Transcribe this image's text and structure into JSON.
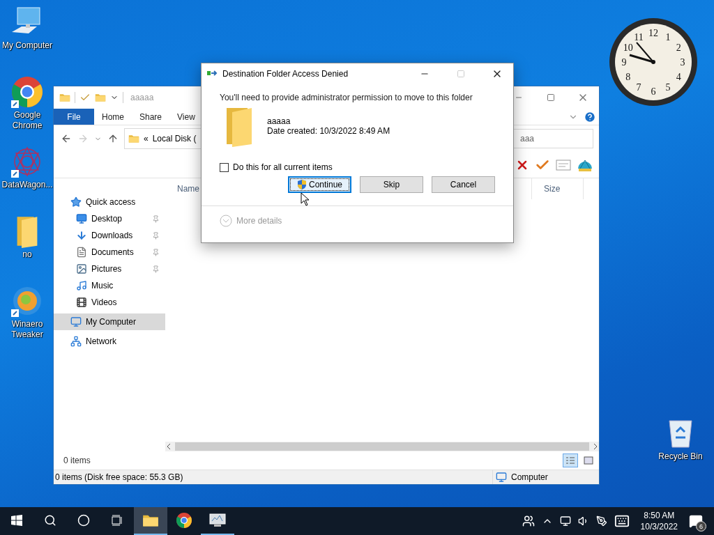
{
  "desktop_icons": [
    {
      "label": "My Computer",
      "kind": "computer"
    },
    {
      "label": "Google Chrome",
      "kind": "chrome"
    },
    {
      "label": "DataWagon...",
      "kind": "datawagon"
    },
    {
      "label": "no",
      "kind": "folder"
    },
    {
      "label": "Winaero Tweaker",
      "kind": "winaero"
    }
  ],
  "recycle_bin": {
    "label": "Recycle Bin"
  },
  "clock": {
    "numerals": [
      "12",
      "11",
      "1",
      "10",
      "2",
      "9",
      "3",
      "8",
      "4",
      "7",
      "5",
      "6"
    ]
  },
  "explorer": {
    "title": "aaaaa",
    "ribbon_tabs": [
      {
        "label": "File",
        "selected": true
      },
      {
        "label": "Home",
        "selected": false
      },
      {
        "label": "Share",
        "selected": false
      },
      {
        "label": "View",
        "selected": false
      }
    ],
    "address_overflow": "«",
    "address": "Local Disk (",
    "search": "aaa",
    "columns": [
      "Name",
      "Size"
    ],
    "nav": [
      {
        "label": "Quick access",
        "kind": "star",
        "selected": false,
        "children": [
          {
            "label": "Desktop",
            "kind": "desktop",
            "pinned": true,
            "selected": false
          },
          {
            "label": "Downloads",
            "kind": "downloads",
            "pinned": true,
            "selected": false
          },
          {
            "label": "Documents",
            "kind": "documents",
            "pinned": true,
            "selected": false
          },
          {
            "label": "Pictures",
            "kind": "pictures",
            "pinned": true,
            "selected": false
          },
          {
            "label": "Music",
            "kind": "music",
            "pinned": false,
            "selected": false
          },
          {
            "label": "Videos",
            "kind": "videos",
            "pinned": false,
            "selected": false
          }
        ]
      },
      {
        "label": "My Computer",
        "kind": "computer",
        "selected": true
      },
      {
        "label": "Network",
        "kind": "network",
        "selected": false
      }
    ],
    "item_count": "0 items",
    "status_text": "0 items (Disk free space: 55.3 GB)",
    "status_location": "Computer"
  },
  "dialog": {
    "title": "Destination Folder Access Denied",
    "message": "You'll need to provide administrator permission to move to this folder",
    "item_name": "aaaaa",
    "item_date": "Date created: 10/3/2022 8:49 AM",
    "checkbox": {
      "label": "Do this for all current items",
      "checked": false
    },
    "buttons": [
      {
        "label": "Continue",
        "kind": "elevated",
        "focused": true
      },
      {
        "label": "Skip",
        "kind": "plain",
        "focused": false
      },
      {
        "label": "Cancel",
        "kind": "plain",
        "focused": false
      }
    ],
    "more_details": "More details"
  },
  "taskbar": {
    "apps": [
      {
        "kind": "explorer",
        "open": true,
        "active": true
      },
      {
        "kind": "chrome",
        "open": false,
        "active": false
      },
      {
        "kind": "monitor",
        "open": true,
        "active": false
      }
    ],
    "time": "8:50 AM",
    "date": "10/3/2022",
    "notifications": "6"
  }
}
